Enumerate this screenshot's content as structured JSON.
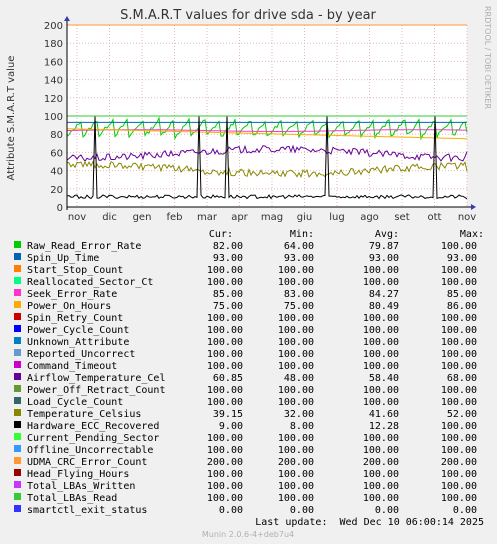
{
  "title": "S.M.A.R.T values for drive sda - by year",
  "ylabel": "Attribute S.M.A.R.T value",
  "watermark": "RRDTOOL / TOBI OETIKER",
  "footer": "Munin 2.0.6-4+deb7u4",
  "last_update": "Last update:  Wed Dec 10 06:00:14 2025",
  "legend_headers": {
    "cur": "Cur:",
    "min": "Min:",
    "avg": "Avg:",
    "max": "Max:"
  },
  "colors": {
    "background": "#f0f0f0",
    "plot_background": "#ffffff",
    "grid": "#e0b8b8",
    "threshold_line": "#e87b00",
    "axis_arrow": "#3a3ab4"
  },
  "chart_data": {
    "type": "line",
    "title": "S.M.A.R.T values for drive sda - by year",
    "xlabel": "",
    "ylabel": "Attribute S.M.A.R.T value",
    "ylim": [
      0,
      200
    ],
    "yticks": [
      0,
      20,
      40,
      60,
      80,
      100,
      120,
      140,
      160,
      180,
      200
    ],
    "xticks": [
      "nov",
      "dic",
      "gen",
      "feb",
      "mar",
      "apr",
      "mag",
      "giu",
      "lug",
      "ago",
      "set",
      "ott",
      "nov"
    ],
    "grid": true,
    "series": [
      {
        "name": "Raw_Read_Error_Rate",
        "color": "#00cc00",
        "cur": "82.00",
        "min": "64.00",
        "avg": "79.87",
        "max": "100.00"
      },
      {
        "name": "Spin_Up_Time",
        "color": "#0066b3",
        "cur": "93.00",
        "min": "93.00",
        "avg": "93.00",
        "max": "93.00"
      },
      {
        "name": "Start_Stop_Count",
        "color": "#ff8000",
        "cur": "100.00",
        "min": "100.00",
        "avg": "100.00",
        "max": "100.00"
      },
      {
        "name": "Reallocated_Sector_Ct",
        "color": "#00ff80",
        "cur": "100.00",
        "min": "100.00",
        "avg": "100.00",
        "max": "100.00"
      },
      {
        "name": "Seek_Error_Rate",
        "color": "#ff33cc",
        "cur": "85.00",
        "min": "83.00",
        "avg": "84.27",
        "max": "85.00"
      },
      {
        "name": "Power_On_Hours",
        "color": "#ffaa00",
        "cur": "75.00",
        "min": "75.00",
        "avg": "80.49",
        "max": "86.00"
      },
      {
        "name": "Spin_Retry_Count",
        "color": "#cc0000",
        "cur": "100.00",
        "min": "100.00",
        "avg": "100.00",
        "max": "100.00"
      },
      {
        "name": "Power_Cycle_Count",
        "color": "#0000ff",
        "cur": "100.00",
        "min": "100.00",
        "avg": "100.00",
        "max": "100.00"
      },
      {
        "name": "Unknown_Attribute",
        "color": "#0080c0",
        "cur": "100.00",
        "min": "100.00",
        "avg": "100.00",
        "max": "100.00"
      },
      {
        "name": "Reported_Uncorrect",
        "color": "#6699cc",
        "cur": "100.00",
        "min": "100.00",
        "avg": "100.00",
        "max": "100.00"
      },
      {
        "name": "Command_Timeout",
        "color": "#cc00cc",
        "cur": "100.00",
        "min": "100.00",
        "avg": "100.00",
        "max": "100.00"
      },
      {
        "name": "Airflow_Temperature_Cel",
        "color": "#660099",
        "cur": "60.85",
        "min": "48.00",
        "avg": "58.40",
        "max": "68.00"
      },
      {
        "name": "Power_Off_Retract_Count",
        "color": "#669933",
        "cur": "100.00",
        "min": "100.00",
        "avg": "100.00",
        "max": "100.00"
      },
      {
        "name": "Load_Cycle_Count",
        "color": "#336666",
        "cur": "100.00",
        "min": "100.00",
        "avg": "100.00",
        "max": "100.00"
      },
      {
        "name": "Temperature_Celsius",
        "color": "#888800",
        "cur": "39.15",
        "min": "32.00",
        "avg": "41.60",
        "max": "52.00"
      },
      {
        "name": "Hardware_ECC_Recovered",
        "color": "#000000",
        "cur": "9.00",
        "min": "8.00",
        "avg": "12.28",
        "max": "100.00"
      },
      {
        "name": "Current_Pending_Sector",
        "color": "#33ff33",
        "cur": "100.00",
        "min": "100.00",
        "avg": "100.00",
        "max": "100.00"
      },
      {
        "name": "Offline_Uncorrectable",
        "color": "#3399ff",
        "cur": "100.00",
        "min": "100.00",
        "avg": "100.00",
        "max": "100.00"
      },
      {
        "name": "UDMA_CRC_Error_Count",
        "color": "#ff9933",
        "cur": "200.00",
        "min": "200.00",
        "avg": "200.00",
        "max": "200.00"
      },
      {
        "name": "Head_Flying_Hours",
        "color": "#990000",
        "cur": "100.00",
        "min": "100.00",
        "avg": "100.00",
        "max": "100.00"
      },
      {
        "name": "Total_LBAs_Written",
        "color": "#cc33ff",
        "cur": "100.00",
        "min": "100.00",
        "avg": "100.00",
        "max": "100.00"
      },
      {
        "name": "Total_LBAs_Read",
        "color": "#33cc33",
        "cur": "100.00",
        "min": "100.00",
        "avg": "100.00",
        "max": "100.00"
      },
      {
        "name": "smartctl_exit_status",
        "color": "#3333ff",
        "cur": "0.00",
        "min": "0.00",
        "avg": "0.00",
        "max": "0.00"
      }
    ]
  }
}
